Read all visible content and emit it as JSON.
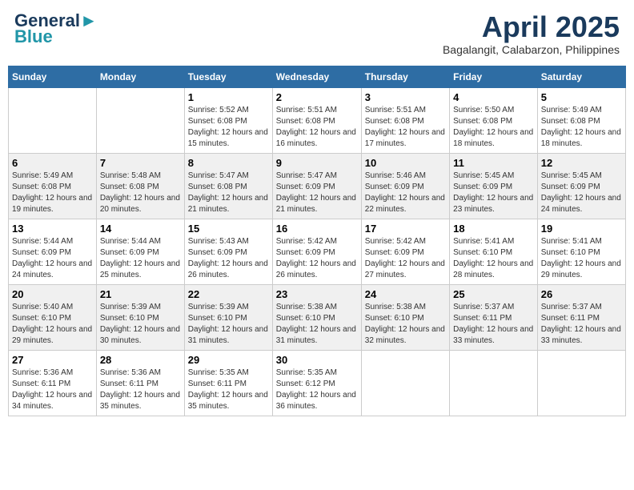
{
  "header": {
    "logo_line1": "General",
    "logo_line2": "Blue",
    "month_title": "April 2025",
    "subtitle": "Bagalangit, Calabarzon, Philippines"
  },
  "weekdays": [
    "Sunday",
    "Monday",
    "Tuesday",
    "Wednesday",
    "Thursday",
    "Friday",
    "Saturday"
  ],
  "weeks": [
    [
      {
        "day": "",
        "info": ""
      },
      {
        "day": "",
        "info": ""
      },
      {
        "day": "1",
        "info": "Sunrise: 5:52 AM\nSunset: 6:08 PM\nDaylight: 12 hours and 15 minutes."
      },
      {
        "day": "2",
        "info": "Sunrise: 5:51 AM\nSunset: 6:08 PM\nDaylight: 12 hours and 16 minutes."
      },
      {
        "day": "3",
        "info": "Sunrise: 5:51 AM\nSunset: 6:08 PM\nDaylight: 12 hours and 17 minutes."
      },
      {
        "day": "4",
        "info": "Sunrise: 5:50 AM\nSunset: 6:08 PM\nDaylight: 12 hours and 18 minutes."
      },
      {
        "day": "5",
        "info": "Sunrise: 5:49 AM\nSunset: 6:08 PM\nDaylight: 12 hours and 18 minutes."
      }
    ],
    [
      {
        "day": "6",
        "info": "Sunrise: 5:49 AM\nSunset: 6:08 PM\nDaylight: 12 hours and 19 minutes."
      },
      {
        "day": "7",
        "info": "Sunrise: 5:48 AM\nSunset: 6:08 PM\nDaylight: 12 hours and 20 minutes."
      },
      {
        "day": "8",
        "info": "Sunrise: 5:47 AM\nSunset: 6:08 PM\nDaylight: 12 hours and 21 minutes."
      },
      {
        "day": "9",
        "info": "Sunrise: 5:47 AM\nSunset: 6:09 PM\nDaylight: 12 hours and 21 minutes."
      },
      {
        "day": "10",
        "info": "Sunrise: 5:46 AM\nSunset: 6:09 PM\nDaylight: 12 hours and 22 minutes."
      },
      {
        "day": "11",
        "info": "Sunrise: 5:45 AM\nSunset: 6:09 PM\nDaylight: 12 hours and 23 minutes."
      },
      {
        "day": "12",
        "info": "Sunrise: 5:45 AM\nSunset: 6:09 PM\nDaylight: 12 hours and 24 minutes."
      }
    ],
    [
      {
        "day": "13",
        "info": "Sunrise: 5:44 AM\nSunset: 6:09 PM\nDaylight: 12 hours and 24 minutes."
      },
      {
        "day": "14",
        "info": "Sunrise: 5:44 AM\nSunset: 6:09 PM\nDaylight: 12 hours and 25 minutes."
      },
      {
        "day": "15",
        "info": "Sunrise: 5:43 AM\nSunset: 6:09 PM\nDaylight: 12 hours and 26 minutes."
      },
      {
        "day": "16",
        "info": "Sunrise: 5:42 AM\nSunset: 6:09 PM\nDaylight: 12 hours and 26 minutes."
      },
      {
        "day": "17",
        "info": "Sunrise: 5:42 AM\nSunset: 6:09 PM\nDaylight: 12 hours and 27 minutes."
      },
      {
        "day": "18",
        "info": "Sunrise: 5:41 AM\nSunset: 6:10 PM\nDaylight: 12 hours and 28 minutes."
      },
      {
        "day": "19",
        "info": "Sunrise: 5:41 AM\nSunset: 6:10 PM\nDaylight: 12 hours and 29 minutes."
      }
    ],
    [
      {
        "day": "20",
        "info": "Sunrise: 5:40 AM\nSunset: 6:10 PM\nDaylight: 12 hours and 29 minutes."
      },
      {
        "day": "21",
        "info": "Sunrise: 5:39 AM\nSunset: 6:10 PM\nDaylight: 12 hours and 30 minutes."
      },
      {
        "day": "22",
        "info": "Sunrise: 5:39 AM\nSunset: 6:10 PM\nDaylight: 12 hours and 31 minutes."
      },
      {
        "day": "23",
        "info": "Sunrise: 5:38 AM\nSunset: 6:10 PM\nDaylight: 12 hours and 31 minutes."
      },
      {
        "day": "24",
        "info": "Sunrise: 5:38 AM\nSunset: 6:10 PM\nDaylight: 12 hours and 32 minutes."
      },
      {
        "day": "25",
        "info": "Sunrise: 5:37 AM\nSunset: 6:11 PM\nDaylight: 12 hours and 33 minutes."
      },
      {
        "day": "26",
        "info": "Sunrise: 5:37 AM\nSunset: 6:11 PM\nDaylight: 12 hours and 33 minutes."
      }
    ],
    [
      {
        "day": "27",
        "info": "Sunrise: 5:36 AM\nSunset: 6:11 PM\nDaylight: 12 hours and 34 minutes."
      },
      {
        "day": "28",
        "info": "Sunrise: 5:36 AM\nSunset: 6:11 PM\nDaylight: 12 hours and 35 minutes."
      },
      {
        "day": "29",
        "info": "Sunrise: 5:35 AM\nSunset: 6:11 PM\nDaylight: 12 hours and 35 minutes."
      },
      {
        "day": "30",
        "info": "Sunrise: 5:35 AM\nSunset: 6:12 PM\nDaylight: 12 hours and 36 minutes."
      },
      {
        "day": "",
        "info": ""
      },
      {
        "day": "",
        "info": ""
      },
      {
        "day": "",
        "info": ""
      }
    ]
  ]
}
